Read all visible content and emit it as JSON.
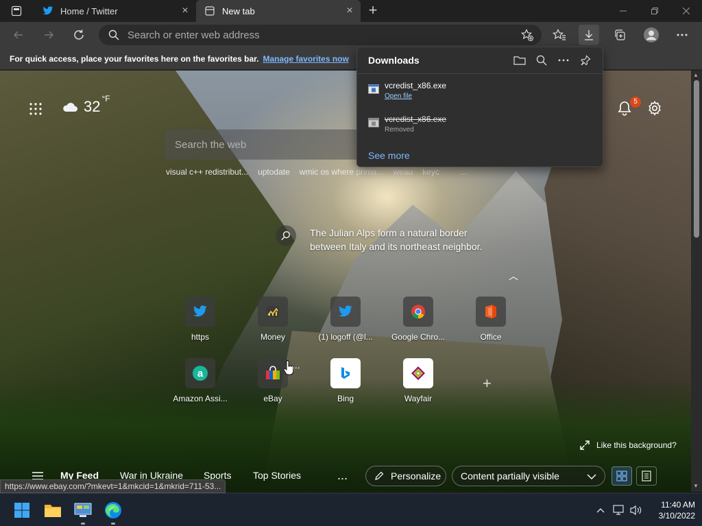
{
  "tabs": [
    {
      "title": "Home / Twitter",
      "icon": "twitter-icon",
      "active": false
    },
    {
      "title": "New tab",
      "icon": "newtab-page-icon",
      "active": true
    }
  ],
  "toolbar": {
    "address_placeholder": "Search or enter web address"
  },
  "favorites_bar": {
    "message": "For quick access, place your favorites here on the favorites bar.",
    "link": "Manage favorites now"
  },
  "weather": {
    "temp": "32",
    "unit": "°F",
    "icon": "cloud-icon"
  },
  "notifications": {
    "count": "5"
  },
  "search": {
    "placeholder": "Search the web"
  },
  "trending": [
    "visual c++ redistribut...",
    "uptodate",
    "wmic os where prima...",
    "weau",
    "keyc"
  ],
  "trending_more": "...",
  "caption": "The Julian Alps form a natural border between Italy and its northeast neighbor.",
  "tiles": [
    {
      "label": "https",
      "icon": "twitter-icon"
    },
    {
      "label": "Money",
      "icon": "money-icon"
    },
    {
      "label": "(1) logoff (@l...",
      "icon": "twitter-icon"
    },
    {
      "label": "Google Chro...",
      "icon": "chrome-icon"
    },
    {
      "label": "Office",
      "icon": "office-icon"
    },
    {
      "label": "Amazon Assi...",
      "icon": "amazon-assistant-icon"
    },
    {
      "label": "eBay",
      "icon": "ebay-icon"
    },
    {
      "label": "Bing",
      "icon": "bing-icon"
    },
    {
      "label": "Wayfair",
      "icon": "wayfair-icon"
    }
  ],
  "tile_more": "...",
  "like_background": "Like this background?",
  "feed": {
    "tabs": [
      "My Feed",
      "War in Ukraine",
      "Sports",
      "Top Stories"
    ],
    "more": "...",
    "personalize": "Personalize",
    "content_visibility": "Content partially visible"
  },
  "downloads": {
    "title": "Downloads",
    "items": [
      {
        "name": "vcredist_x86.exe",
        "status": "Open file",
        "removed": false
      },
      {
        "name": "vcredist_x86.exe",
        "status": "Removed",
        "removed": true
      }
    ],
    "see_more": "See more"
  },
  "status_url": "https://www.ebay.com/?mkevt=1&mkcid=1&mkrid=711-53...",
  "clock": {
    "time": "11:40 AM",
    "date": "3/10/2022"
  },
  "colors": {
    "accent": "#7db8ff",
    "badge": "#d9481a",
    "edge_blue": "#0c8ce9"
  }
}
